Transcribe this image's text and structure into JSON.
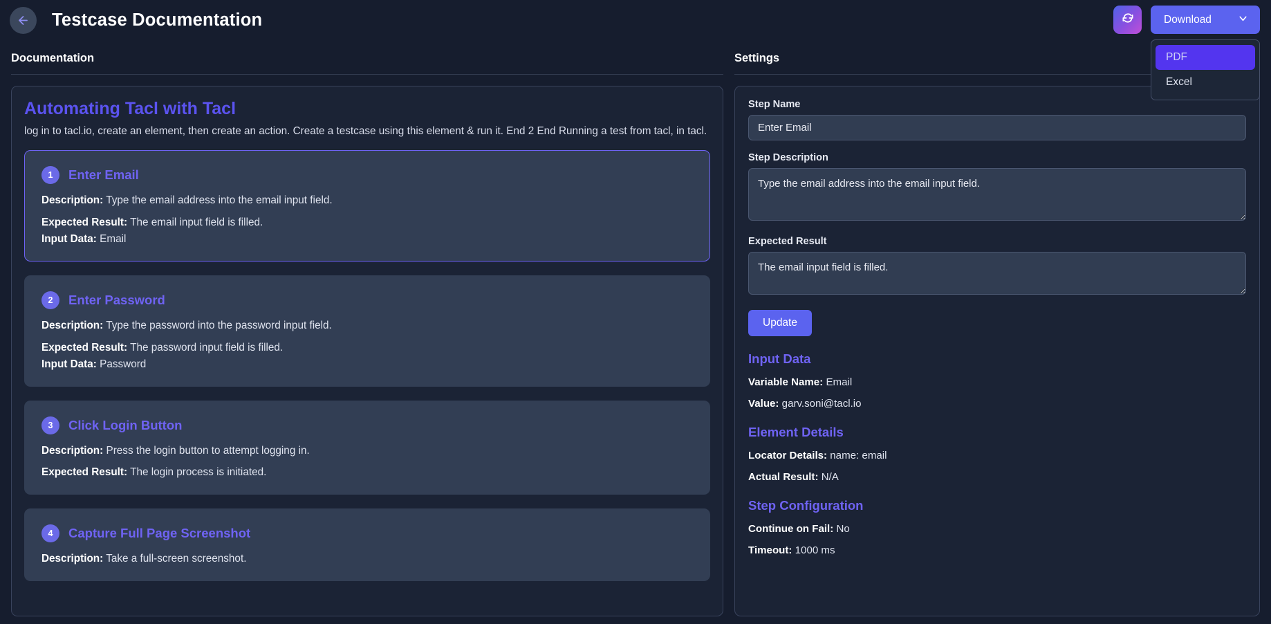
{
  "header": {
    "back_icon": "arrow-left-icon",
    "title": "Testcase Documentation",
    "refresh_icon": "refresh-icon",
    "download_label": "Download",
    "chevron_icon": "chevron-down-icon",
    "menu": [
      {
        "label": "PDF",
        "active": true
      },
      {
        "label": "Excel",
        "active": false
      }
    ]
  },
  "left": {
    "section_label": "Documentation",
    "doc_title": "Automating Tacl with Tacl",
    "doc_subtitle": "log in to tacl.io, create an element, then create an action. Create a testcase using this element & run it. End 2 End Running a test from tacl, in tacl.",
    "labels": {
      "description": "Description:",
      "expected_result": "Expected Result:",
      "input_data": "Input Data:"
    },
    "steps": [
      {
        "num": "1",
        "name": "Enter Email",
        "description": "Type the email address into the email input field.",
        "expected_result": "The email input field is filled.",
        "input_data": "Email",
        "selected": true
      },
      {
        "num": "2",
        "name": "Enter Password",
        "description": "Type the password into the password input field.",
        "expected_result": "The password input field is filled.",
        "input_data": "Password",
        "selected": false
      },
      {
        "num": "3",
        "name": "Click Login Button",
        "description": "Press the login button to attempt logging in.",
        "expected_result": "The login process is initiated.",
        "input_data": "",
        "selected": false
      },
      {
        "num": "4",
        "name": "Capture Full Page Screenshot",
        "description": "Take a full-screen screenshot.",
        "expected_result": "",
        "input_data": "",
        "selected": false
      }
    ]
  },
  "right": {
    "section_label": "Settings",
    "step_name_label": "Step Name",
    "step_name_value": "Enter Email",
    "step_name_placeholder": "Enter Email",
    "step_description_label": "Step Description",
    "step_description_value": "Type the email address into the email input field.",
    "expected_result_label": "Expected Result",
    "expected_result_value": "The email input field is filled.",
    "update_label": "Update",
    "input_data": {
      "heading": "Input Data",
      "variable_name_label": "Variable Name:",
      "variable_name_value": "Email",
      "value_label": "Value:",
      "value_value": "garv.soni@tacl.io"
    },
    "element_details": {
      "heading": "Element Details",
      "locator_label": "Locator Details:",
      "locator_value": "name: email",
      "actual_result_label": "Actual Result:",
      "actual_result_value": "N/A"
    },
    "step_configuration": {
      "heading": "Step Configuration",
      "continue_on_fail_label": "Continue on Fail:",
      "continue_on_fail_value": "No",
      "timeout_label": "Timeout:",
      "timeout_value": "1000 ms"
    }
  },
  "colors": {
    "page_bg": "#161d2e",
    "panel_bg": "#1b2335",
    "card_bg": "#323e54",
    "accent": "#5b63ef",
    "accent_text": "#6f63f3",
    "selected_border": "#6e63f5"
  }
}
